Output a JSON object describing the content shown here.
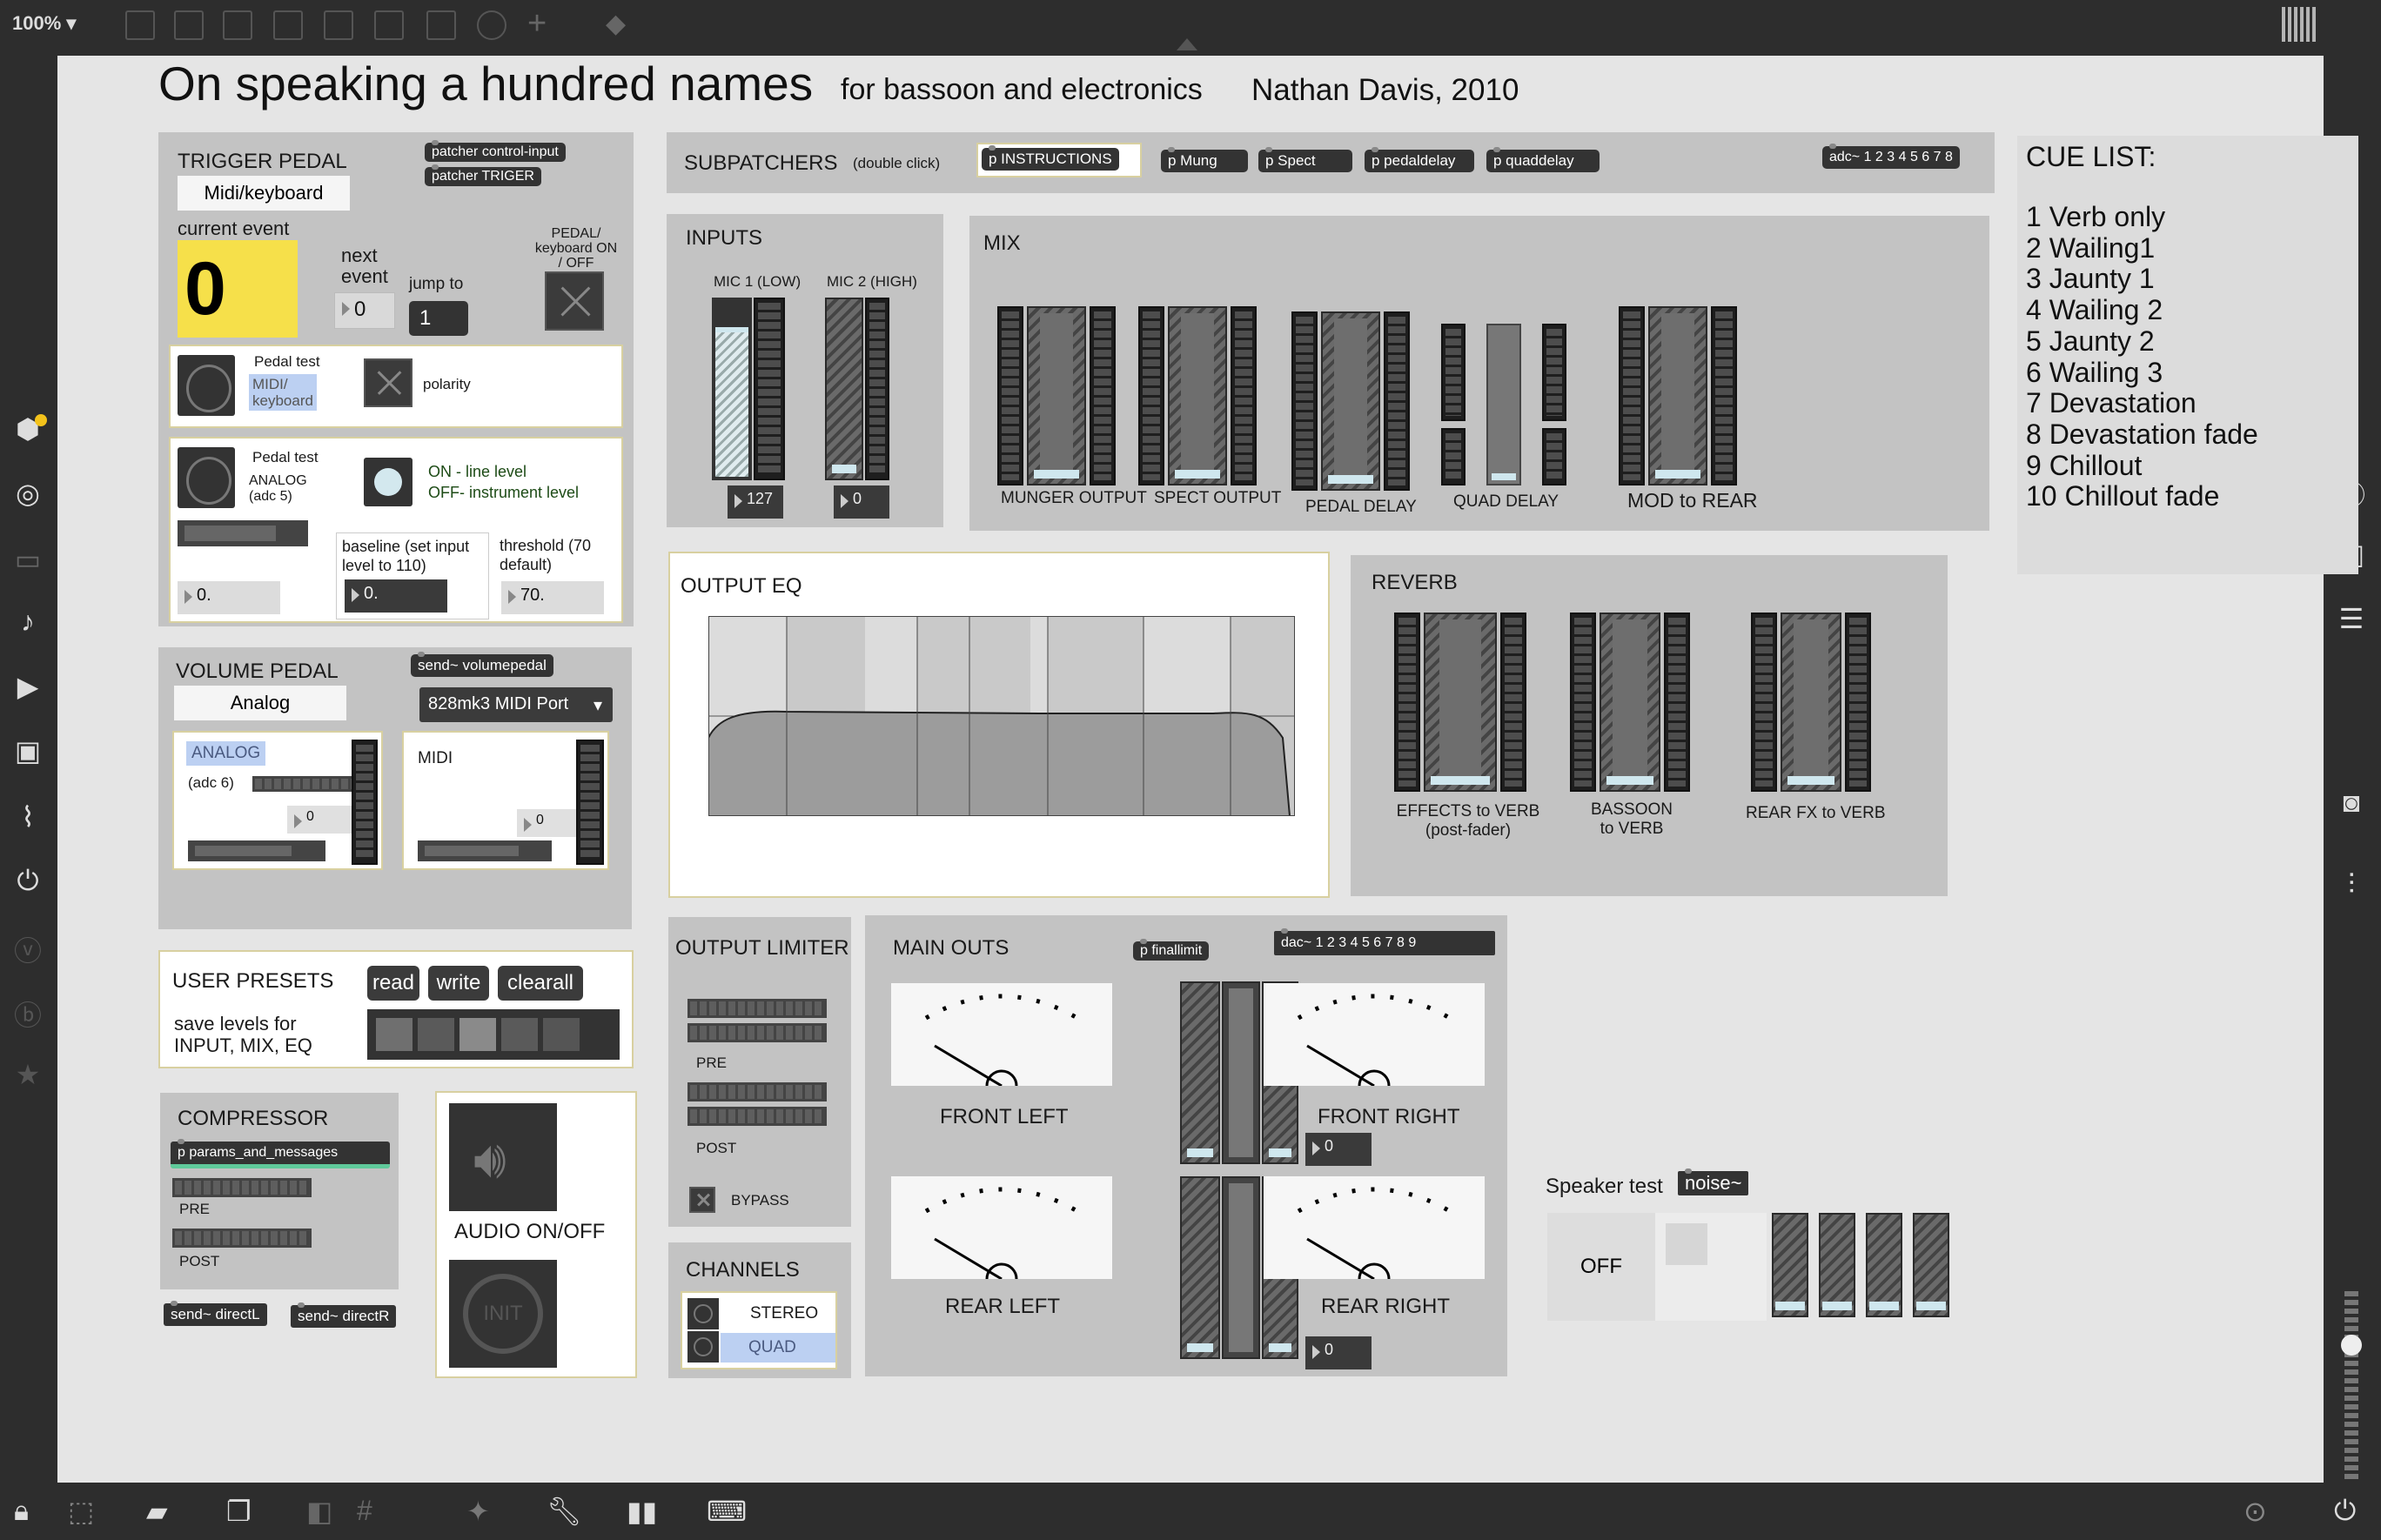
{
  "toolbar": {
    "zoom": "100%"
  },
  "header": {
    "title": "On speaking a hundred names",
    "subtitle": "for bassoon and electronics",
    "composer": "Nathan Davis, 2010"
  },
  "trigger_pedal": {
    "label": "TRIGGER PEDAL",
    "mode": "Midi/keyboard",
    "obj_control": "patcher control-input",
    "obj_triger": "patcher TRIGER",
    "current_event_label": "current event",
    "current_event": "0",
    "next_event_label": "next event",
    "next_event": "0",
    "jump_label": "jump to",
    "jump_value": "1",
    "pedal_toggle_label": "PEDAL/ keyboard ON / OFF",
    "pedal_test": "Pedal test",
    "midi_keyboard": "MIDI/ keyboard",
    "polarity": "polarity",
    "pedal_test2": "Pedal test",
    "analog": "ANALOG (adc 5)",
    "on_line": "ON - line level",
    "off_instr": "OFF- instrument level",
    "baseline_label": "baseline (set input level to 110)",
    "threshold_label": "threshold (70 default)",
    "analog_value": "0.",
    "baseline_value": "0.",
    "threshold_value": "70."
  },
  "volume_pedal": {
    "label": "VOLUME PEDAL",
    "mode": "Analog",
    "send": "send~ volumepedal",
    "midi_port": "828mk3 MIDI Port",
    "analog": "ANALOG",
    "adc": "(adc 6)",
    "analog_value": "0",
    "midi": "MIDI",
    "midi_value": "0"
  },
  "presets": {
    "label": "USER PRESETS",
    "read": "read",
    "write": "write",
    "clearall": "clearall",
    "desc": "save levels for INPUT, MIX, EQ"
  },
  "compressor": {
    "label": "COMPRESSOR",
    "params": "p params_and_messages",
    "pre": "PRE",
    "post": "POST",
    "send_l": "send~ directL",
    "send_r": "send~ directR"
  },
  "audio": {
    "label": "AUDIO ON/OFF",
    "init": "INIT"
  },
  "subpatchers": {
    "label": "SUBPATCHERS",
    "hint": "(double click)",
    "items": [
      "p INSTRUCTIONS",
      "p Mung",
      "p Spect",
      "p pedaldelay",
      "p quaddelay"
    ],
    "adc": "adc~ 1 2 3 4 5 6 7 8"
  },
  "inputs": {
    "label": "INPUTS",
    "mic1": "MIC 1 (LOW)",
    "mic2": "MIC 2 (HIGH)",
    "mic1_value": "127",
    "mic2_value": "0"
  },
  "mix": {
    "label": "MIX",
    "munger": "MUNGER OUTPUT",
    "spect": "SPECT OUTPUT",
    "pedal_delay": "PEDAL DELAY",
    "quad_delay": "QUAD DELAY",
    "mod_rear": "MOD to REAR"
  },
  "output_eq": {
    "label": "OUTPUT EQ"
  },
  "reverb": {
    "label": "REVERB",
    "effects": "EFFECTS to VERB (post-fader)",
    "bassoon": "BASSOON to VERB",
    "rear": "REAR  FX to VERB"
  },
  "limiter": {
    "label": "OUTPUT LIMITER",
    "pre": "PRE",
    "post": "POST",
    "bypass": "BYPASS"
  },
  "channels": {
    "label": "CHANNELS",
    "stereo": "STEREO",
    "quad": "QUAD"
  },
  "main_outs": {
    "label": "MAIN OUTS",
    "finallimit": "p finallimit",
    "dac": "dac~ 1 2 3 4 5 6 7 8 9",
    "front_left": "FRONT LEFT",
    "front_right": "FRONT RIGHT",
    "rear_left": "REAR LEFT",
    "rear_right": "REAR RIGHT",
    "front_value": "0",
    "rear_value": "0"
  },
  "speaker_test": {
    "label": "Speaker test",
    "noise": "noise~",
    "off": "OFF"
  },
  "cue_list": {
    "label": "CUE LIST:",
    "items": [
      "1 Verb only",
      "2  Wailing1",
      "3  Jaunty 1",
      "4  Wailing 2",
      "5  Jaunty 2",
      "6  Wailing 3",
      "7  Devastation",
      "8  Devastation fade",
      "9  Chillout",
      "10 Chillout fade"
    ]
  },
  "colors": {
    "canvas": "#e5e5e5",
    "panel": "#c3c3c3",
    "event_yellow": "#f6e04a",
    "highlight_blue": "#bcd0f2"
  },
  "icons": [
    "cube-icon",
    "target-icon",
    "music-note-icon",
    "image-icon",
    "paperclip-icon",
    "plug-icon",
    "search-icon",
    "info-icon",
    "list-icon",
    "camera-icon",
    "sliders-icon",
    "lock-icon",
    "wrench-icon",
    "power-icon"
  ]
}
